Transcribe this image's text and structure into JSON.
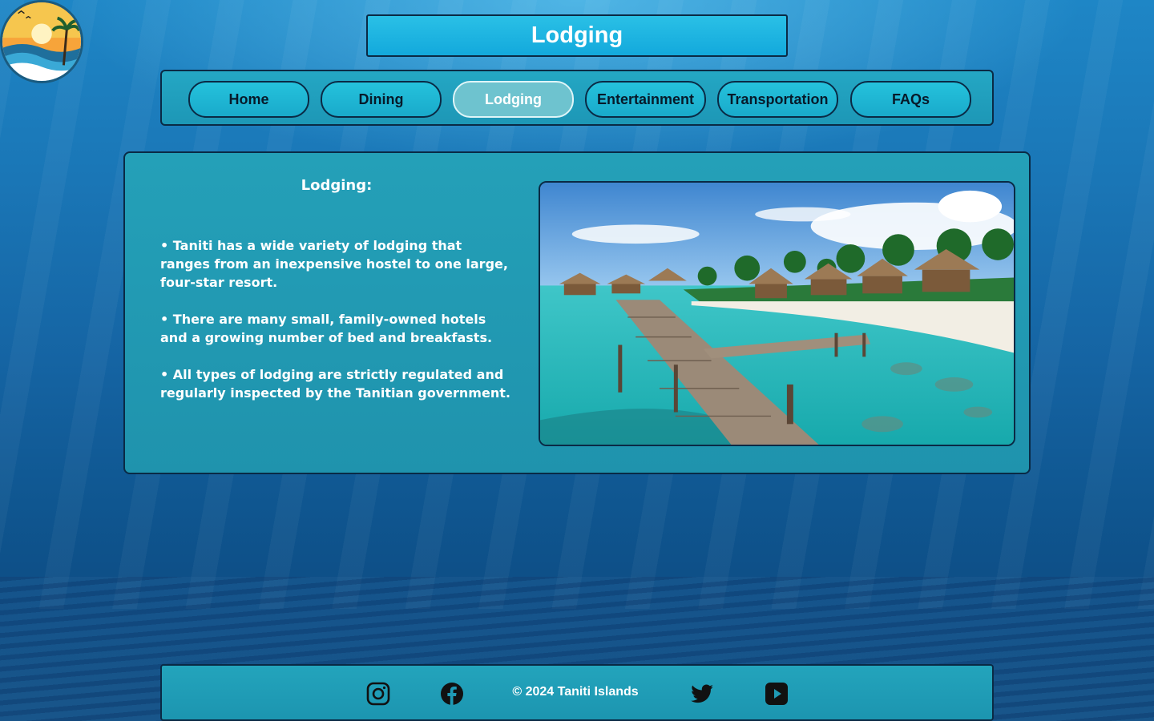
{
  "page": {
    "title": "Lodging"
  },
  "logo": {
    "icon": "taniti-islands-logo-icon"
  },
  "nav": {
    "items": [
      {
        "label": "Home",
        "active": false
      },
      {
        "label": "Dining",
        "active": false
      },
      {
        "label": "Lodging",
        "active": true
      },
      {
        "label": "Entertainment",
        "active": false
      },
      {
        "label": "Transportation",
        "active": false
      },
      {
        "label": "FAQs",
        "active": false
      }
    ]
  },
  "main": {
    "heading": "Lodging:",
    "bullets": [
      "• Taniti has a wide variety of lodging that ranges from an inexpensive hostel to one large, four-star resort.",
      "• There are many small, family-owned hotels and a growing number of bed and breakfasts.",
      "• All types of lodging are strictly regulated and regularly inspected by the Tanitian government."
    ],
    "image_icon": "overwater-bungalows-photo"
  },
  "footer": {
    "copyright": "© 2024 Taniti Islands",
    "social": [
      "instagram-icon",
      "facebook-icon",
      "twitter-icon",
      "youtube-icon"
    ]
  },
  "colors": {
    "accent": "#19aacb",
    "border": "#0a2a45",
    "active_nav": "#6ec3cf",
    "text_light": "#ffffff"
  }
}
